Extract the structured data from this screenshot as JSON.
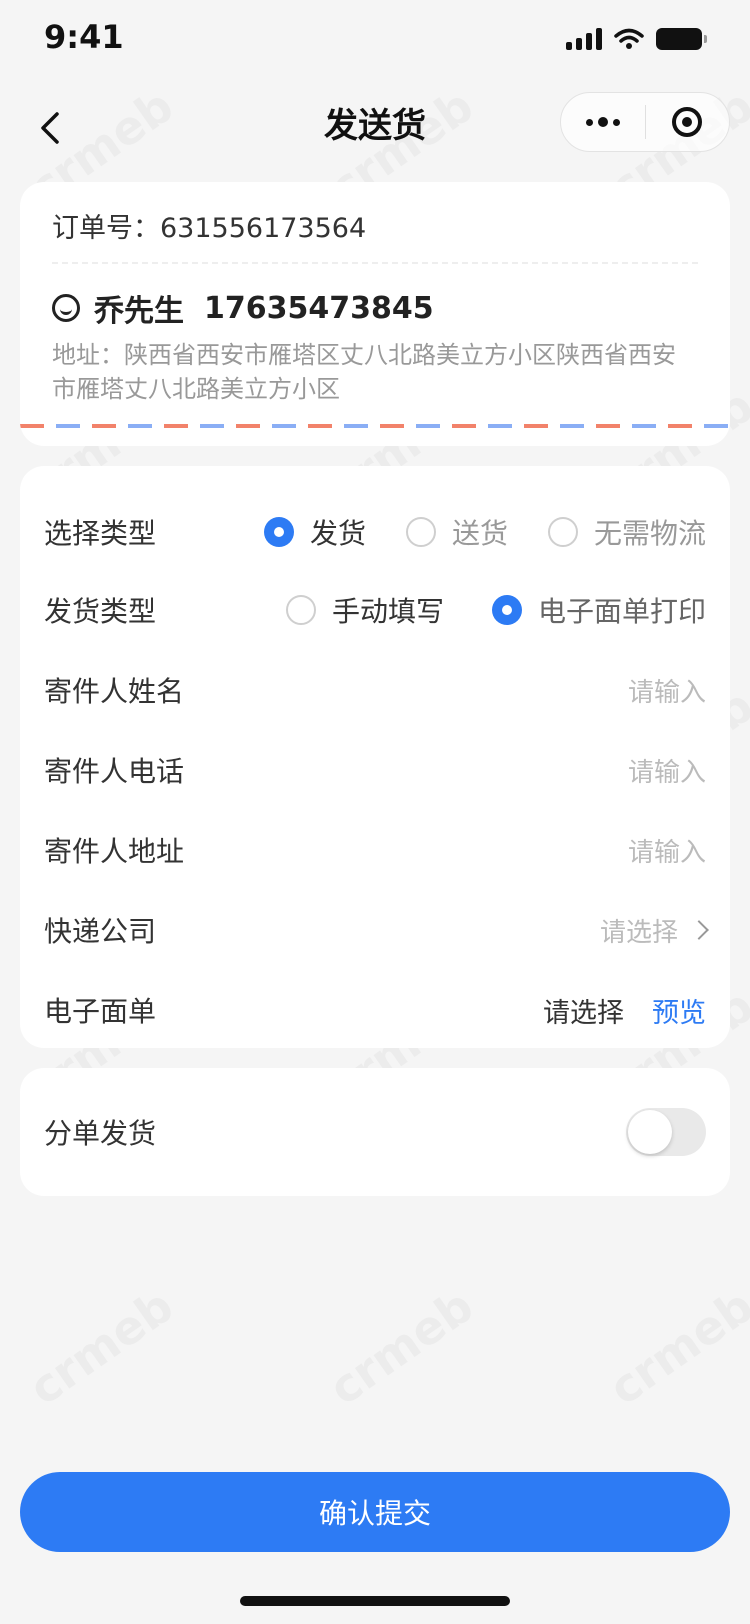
{
  "status_bar": {
    "time": "9:41"
  },
  "nav": {
    "title": "发送货"
  },
  "order": {
    "order_no_label": "订单号：",
    "order_no": "631556173564",
    "name": "乔先生",
    "phone": "17635473845",
    "address_label": "地址：",
    "address": "陕西省西安市雁塔区丈八北路美立方小区陕西省西安市雁塔丈八北路美立方小区"
  },
  "form": {
    "type": {
      "label": "选择类型",
      "options": [
        {
          "label": "发货",
          "selected": true
        },
        {
          "label": "送货",
          "selected": false
        },
        {
          "label": "无需物流",
          "selected": false
        }
      ]
    },
    "ship_type": {
      "label": "发货类型",
      "options": [
        {
          "label": "手动填写",
          "selected": false
        },
        {
          "label": "电子面单打印",
          "selected": true
        }
      ]
    },
    "sender_name": {
      "label": "寄件人姓名",
      "placeholder": "请输入"
    },
    "sender_phone": {
      "label": "寄件人电话",
      "placeholder": "请输入"
    },
    "sender_address": {
      "label": "寄件人地址",
      "placeholder": "请输入"
    },
    "courier": {
      "label": "快递公司",
      "placeholder": "请选择"
    },
    "waybill": {
      "label": "电子面单",
      "select_text": "请选择",
      "preview": "预览"
    }
  },
  "split": {
    "label": "分单发货",
    "enabled": false
  },
  "submit": {
    "label": "确认提交"
  },
  "watermark_text": "crmeb",
  "colors": {
    "accent": "#2d7bf4",
    "background": "#f5f5f5"
  }
}
